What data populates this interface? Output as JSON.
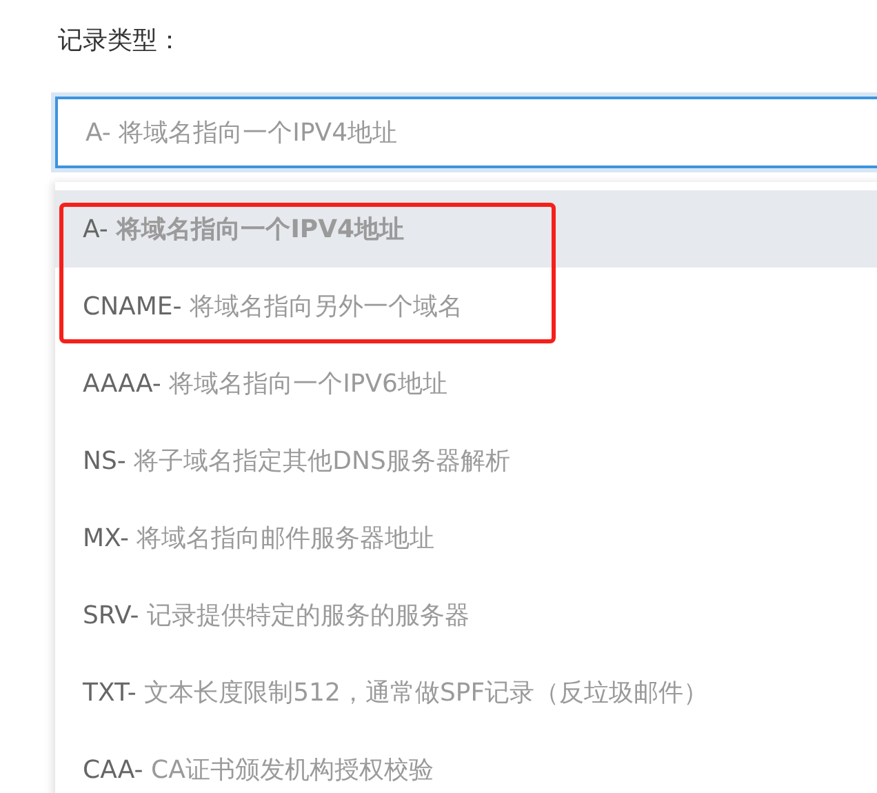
{
  "field": {
    "label": "记录类型：",
    "value": "A- 将域名指向一个IPV4地址",
    "focused": true
  },
  "options": [
    {
      "code": "A-",
      "description": "将域名指向一个IPV4地址",
      "selected": true
    },
    {
      "code": "CNAME-",
      "description": "将域名指向另外一个域名",
      "selected": false
    },
    {
      "code": "AAAA-",
      "description": "将域名指向一个IPV6地址",
      "selected": false
    },
    {
      "code": "NS-",
      "description": "将子域名指定其他DNS服务器解析",
      "selected": false
    },
    {
      "code": "MX-",
      "description": "将域名指向邮件服务器地址",
      "selected": false
    },
    {
      "code": "SRV-",
      "description": "记录提供特定的服务的服务器",
      "selected": false
    },
    {
      "code": "TXT-",
      "description": "文本长度限制512，通常做SPF记录（反垃圾邮件）",
      "selected": false
    },
    {
      "code": "CAA-",
      "description": "CA证书颁发机构授权校验",
      "selected": false
    }
  ]
}
